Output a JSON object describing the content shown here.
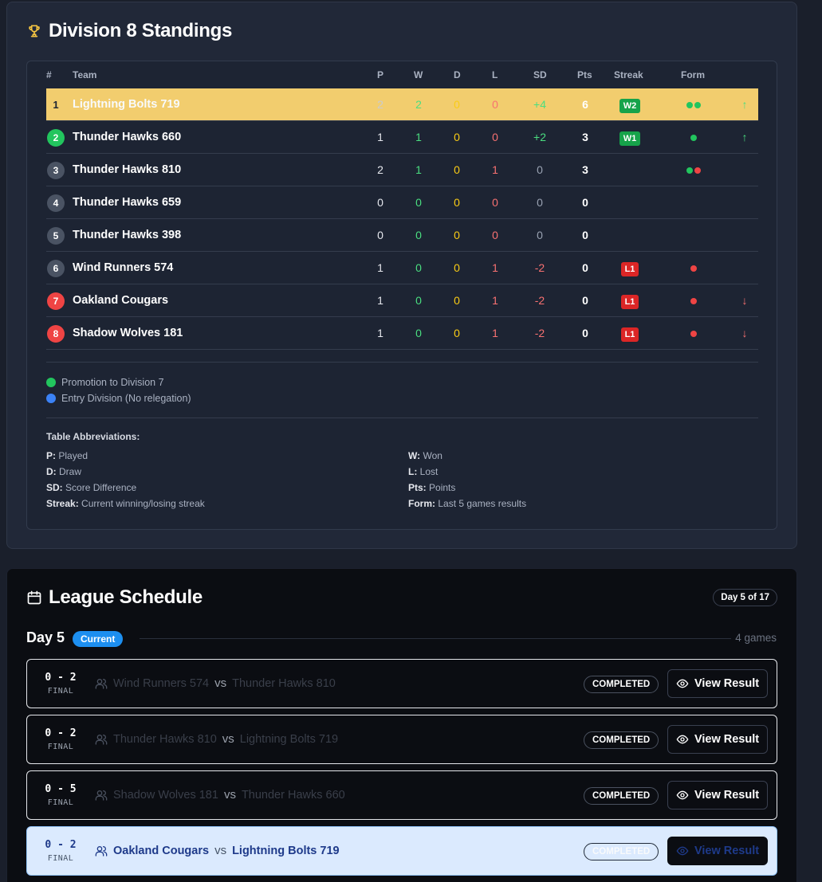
{
  "standings": {
    "title": "Division 8 Standings",
    "headers": {
      "pos": "#",
      "team": "Team",
      "p": "P",
      "w": "W",
      "d": "D",
      "l": "L",
      "sd": "SD",
      "pts": "Pts",
      "streak": "Streak",
      "form": "Form"
    },
    "rows": [
      {
        "pos": "1",
        "team": "Lightning Bolts 719",
        "p": "2",
        "w": "2",
        "d": "0",
        "l": "0",
        "sd": "+4",
        "pts": "6",
        "streak": "W2",
        "form": [
          "W",
          "W"
        ],
        "trend": "↑"
      },
      {
        "pos": "2",
        "team": "Thunder Hawks 660",
        "p": "1",
        "w": "1",
        "d": "0",
        "l": "0",
        "sd": "+2",
        "pts": "3",
        "streak": "W1",
        "form": [
          "W"
        ],
        "trend": "↑"
      },
      {
        "pos": "3",
        "team": "Thunder Hawks 810",
        "p": "2",
        "w": "1",
        "d": "0",
        "l": "1",
        "sd": "0",
        "pts": "3",
        "streak": "",
        "form": [
          "W",
          "L"
        ],
        "trend": ""
      },
      {
        "pos": "4",
        "team": "Thunder Hawks 659",
        "p": "0",
        "w": "0",
        "d": "0",
        "l": "0",
        "sd": "0",
        "pts": "0",
        "streak": "",
        "form": [],
        "trend": ""
      },
      {
        "pos": "5",
        "team": "Thunder Hawks 398",
        "p": "0",
        "w": "0",
        "d": "0",
        "l": "0",
        "sd": "0",
        "pts": "0",
        "streak": "",
        "form": [],
        "trend": ""
      },
      {
        "pos": "6",
        "team": "Wind Runners 574",
        "p": "1",
        "w": "0",
        "d": "0",
        "l": "1",
        "sd": "-2",
        "pts": "0",
        "streak": "L1",
        "form": [
          "L"
        ],
        "trend": ""
      },
      {
        "pos": "7",
        "team": "Oakland Cougars",
        "p": "1",
        "w": "0",
        "d": "0",
        "l": "1",
        "sd": "-2",
        "pts": "0",
        "streak": "L1",
        "form": [
          "L"
        ],
        "trend": "↓"
      },
      {
        "pos": "8",
        "team": "Shadow Wolves 181",
        "p": "1",
        "w": "0",
        "d": "0",
        "l": "1",
        "sd": "-2",
        "pts": "0",
        "streak": "L1",
        "form": [
          "L"
        ],
        "trend": "↓"
      }
    ],
    "legend": [
      {
        "label": "Promotion to Division 7",
        "color": "#22c55e"
      },
      {
        "label": "Entry Division (No relegation)",
        "color": "#3b82f6"
      }
    ],
    "abbr_title": "Table Abbreviations:",
    "abbr": [
      {
        "key": "P:",
        "text": "Played"
      },
      {
        "key": "W:",
        "text": "Won"
      },
      {
        "key": "D:",
        "text": "Draw"
      },
      {
        "key": "L:",
        "text": "Lost"
      },
      {
        "key": "SD:",
        "text": "Score Difference"
      },
      {
        "key": "Pts:",
        "text": "Points"
      },
      {
        "key": "Streak:",
        "text": "Current winning/losing streak"
      },
      {
        "key": "Form:",
        "text": "Last 5 games results"
      }
    ]
  },
  "schedule": {
    "title": "League Schedule",
    "day_pill": "Day 5 of 17",
    "day_label": "Day 5",
    "current_label": "Current",
    "games_count": "4 games",
    "matches": [
      {
        "score": "0 - 2",
        "final": "FINAL",
        "home": "Wind Runners 574",
        "vs": "vs",
        "away": "Thunder Hawks 810",
        "status": "COMPLETED",
        "button": "View Result"
      },
      {
        "score": "0 - 2",
        "final": "FINAL",
        "home": "Thunder Hawks 810",
        "vs": "vs",
        "away": "Lightning Bolts 719",
        "status": "COMPLETED",
        "button": "View Result"
      },
      {
        "score": "0 - 5",
        "final": "FINAL",
        "home": "Shadow Wolves 181",
        "vs": "vs",
        "away": "Thunder Hawks 660",
        "status": "COMPLETED",
        "button": "View Result"
      },
      {
        "score": "0 - 2",
        "final": "FINAL",
        "home": "Oakland Cougars",
        "vs": "vs",
        "away": "Lightning Bolts 719",
        "status": "COMPLETED",
        "button": "View Result"
      }
    ]
  }
}
